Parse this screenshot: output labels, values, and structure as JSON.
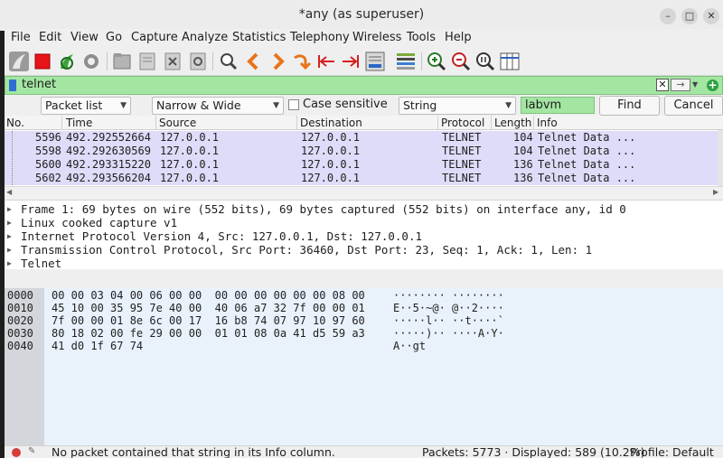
{
  "window": {
    "title": "*any (as superuser)",
    "controls": [
      "–",
      "□",
      "✕"
    ]
  },
  "menu": [
    "File",
    "Edit",
    "View",
    "Go",
    "Capture",
    "Analyze",
    "Statistics",
    "Telephony",
    "Wireless",
    "Tools",
    "Help"
  ],
  "toolbar": {
    "icons": [
      "shark-fin-icon",
      "stop-capture-icon",
      "restart-capture-icon",
      "capture-options-icon",
      "open-file-icon",
      "save-file-icon",
      "close-file-icon",
      "reload-file-icon",
      "find-packet-icon",
      "go-back-icon",
      "go-forward-icon",
      "go-to-packet-icon",
      "first-packet-icon",
      "last-packet-icon",
      "auto-scroll-icon",
      "colorize-icon",
      "zoom-in-icon",
      "zoom-out-icon",
      "normal-size-icon",
      "resize-columns-icon"
    ]
  },
  "filter": {
    "value": "telnet",
    "bg_color": "#a3e6a2"
  },
  "find": {
    "search_in": "Packet list",
    "char_width": "Narrow & Wide",
    "case_sensitive_label": "Case sensitive",
    "case_sensitive_checked": false,
    "search_type": "String",
    "search_value": "labvm",
    "find_label": "Find",
    "cancel_label": "Cancel"
  },
  "packet_list": {
    "columns": [
      "No.",
      "Time",
      "Source",
      "Destination",
      "Protocol",
      "Length",
      "Info"
    ],
    "rows": [
      {
        "no": "5596",
        "time": "492.292552664",
        "source": "127.0.0.1",
        "destination": "127.0.0.1",
        "protocol": "TELNET",
        "length": "104",
        "info": "Telnet Data ..."
      },
      {
        "no": "5598",
        "time": "492.292630569",
        "source": "127.0.0.1",
        "destination": "127.0.0.1",
        "protocol": "TELNET",
        "length": "104",
        "info": "Telnet Data ..."
      },
      {
        "no": "5600",
        "time": "492.293315220",
        "source": "127.0.0.1",
        "destination": "127.0.0.1",
        "protocol": "TELNET",
        "length": "136",
        "info": "Telnet Data ..."
      },
      {
        "no": "5602",
        "time": "492.293566204",
        "source": "127.0.0.1",
        "destination": "127.0.0.1",
        "protocol": "TELNET",
        "length": "136",
        "info": "Telnet Data ..."
      }
    ],
    "row_color": "#dedcf8"
  },
  "details": [
    "Frame 1: 69 bytes on wire (552 bits), 69 bytes captured (552 bits) on interface any, id 0",
    "Linux cooked capture v1",
    "Internet Protocol Version 4, Src: 127.0.0.1, Dst: 127.0.0.1",
    "Transmission Control Protocol, Src Port: 36460, Dst Port: 23, Seq: 1, Ack: 1, Len: 1",
    "Telnet"
  ],
  "bytes": [
    {
      "offset": "0000",
      "hex": "00 00 03 04 00 06 00 00  00 00 00 00 00 00 08 00",
      "ascii": "········ ········"
    },
    {
      "offset": "0010",
      "hex": "45 10 00 35 95 7e 40 00  40 06 a7 32 7f 00 00 01",
      "ascii": "E··5·~@· @··2····"
    },
    {
      "offset": "0020",
      "hex": "7f 00 00 01 8e 6c 00 17  16 b8 74 07 97 10 97 60",
      "ascii": "·····l·· ··t····`"
    },
    {
      "offset": "0030",
      "hex": "80 18 02 00 fe 29 00 00  01 01 08 0a 41 d5 59 a3",
      "ascii": "·····)·· ····A·Y·"
    },
    {
      "offset": "0040",
      "hex": "41 d0 1f 67 74",
      "ascii": "A··gt"
    }
  ],
  "status": {
    "message": "No packet contained that string in its Info column.",
    "packets": "Packets: 5773 · Displayed: 589 (10.2%)",
    "profile": "Profile: Default"
  }
}
